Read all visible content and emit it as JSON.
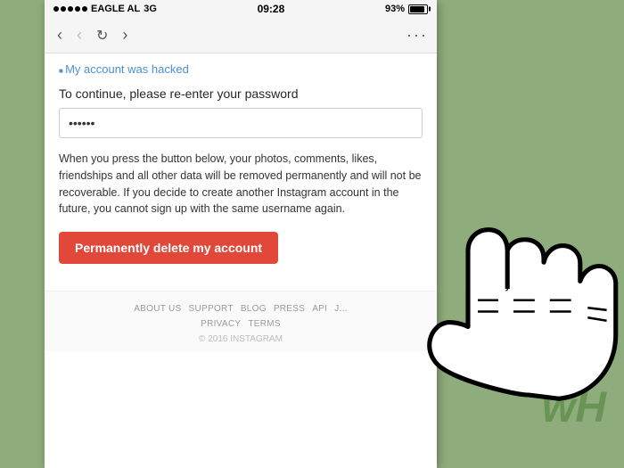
{
  "status_bar": {
    "carrier": "EAGLE AL",
    "network": "3G",
    "time": "09:28",
    "battery": "93%"
  },
  "browser": {
    "back_label": "‹",
    "forward_label": "›",
    "refresh_label": "↻",
    "forward_nav_label": "›",
    "more_label": "···"
  },
  "page": {
    "hacked_link": "My account was hacked",
    "password_label": "To continue, please re-enter your password",
    "password_value": "••••••",
    "warning_text": "When you press the button below, your photos, comments, likes, friendships and all other data will be removed permanently and will not be recoverable. If you decide to create another Instagram account in the future, you cannot sign up with the same username again.",
    "delete_button_label": "Permanently delete my account",
    "footer": {
      "links": [
        "ABOUT US",
        "SUPPORT",
        "BLOG",
        "PRESS",
        "API",
        "J..."
      ],
      "links2": [
        "PRIVACY",
        "TERMS"
      ],
      "copyright": "© 2016 INSTAGRAM"
    }
  },
  "wikihow": {
    "watermark": "wH"
  }
}
